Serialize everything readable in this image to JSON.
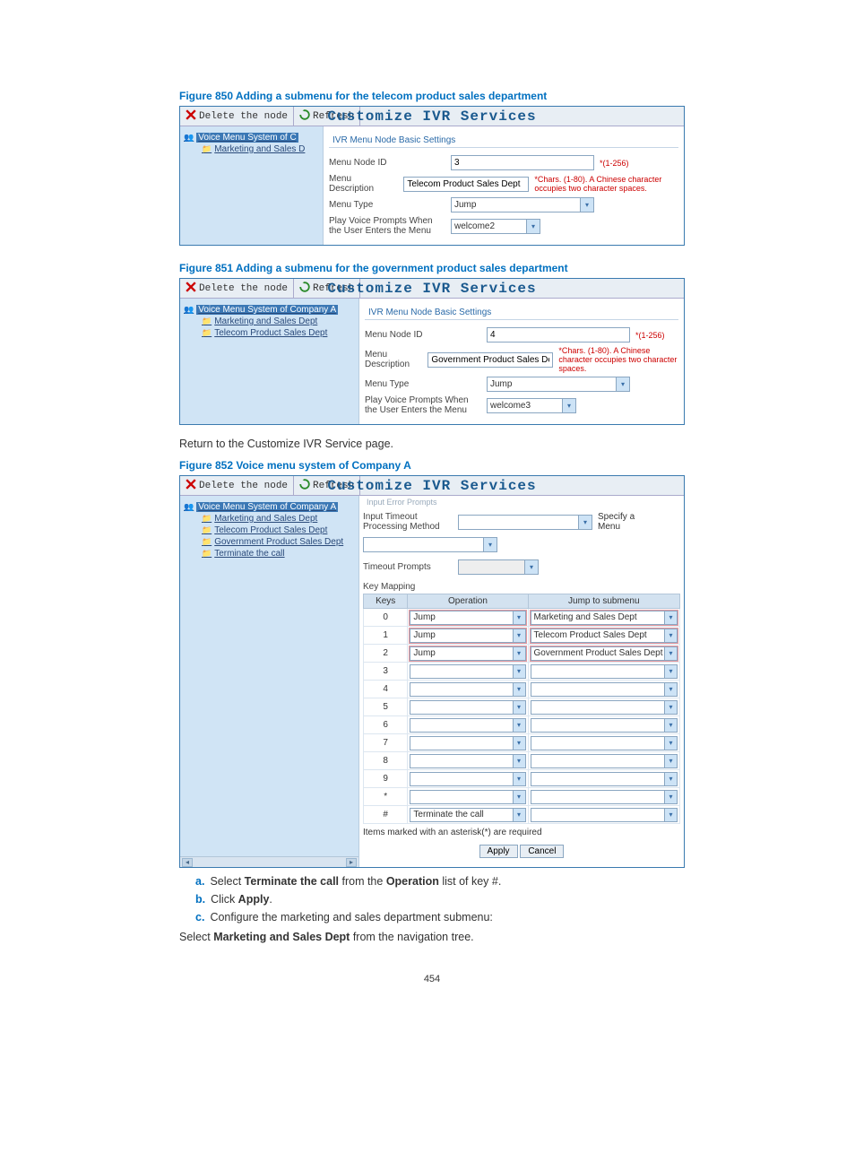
{
  "fig850": {
    "title": "Figure 850 Adding a submenu for the telecom product sales department",
    "banner": "Customize IVR Services",
    "delete": "Delete the node",
    "refresh": "Refresh",
    "tree": {
      "root": "Voice Menu System of C",
      "n1": "Marketing and Sales D"
    },
    "group": "IVR Menu Node Basic Settings",
    "fields": {
      "node_id_label": "Menu Node ID",
      "node_id_value": "3",
      "node_id_hint": "*(1-256)",
      "desc_label": "Menu Description",
      "desc_value": "Telecom Product Sales Dept",
      "desc_hint": "*Chars. (1-80). A Chinese character occupies two character spaces.",
      "type_label": "Menu Type",
      "type_value": "Jump",
      "prompt_label": "Play Voice Prompts When the User Enters the Menu",
      "prompt_value": "welcome2"
    }
  },
  "fig851": {
    "title": "Figure 851 Adding a submenu for the government product sales department",
    "banner": "Customize IVR Services",
    "delete": "Delete the node",
    "refresh": "Refresh",
    "tree": {
      "root": "Voice Menu System of Company A",
      "n1": "Marketing and Sales Dept",
      "n2": "Telecom Product Sales Dept"
    },
    "group": "IVR Menu Node Basic Settings",
    "fields": {
      "node_id_label": "Menu Node ID",
      "node_id_value": "4",
      "node_id_hint": "*(1-256)",
      "desc_label": "Menu Description",
      "desc_value": "Government Product Sales Dept",
      "desc_hint": "*Chars. (1-80). A Chinese character occupies two character spaces.",
      "type_label": "Menu Type",
      "type_value": "Jump",
      "prompt_label": "Play Voice Prompts When the User Enters the Menu",
      "prompt_value": "welcome3"
    }
  },
  "return_text": "Return to the Customize IVR Service page.",
  "fig852": {
    "title": "Figure 852 Voice menu system of Company A",
    "banner": "Customize IVR Services",
    "delete": "Delete the node",
    "refresh": "Refresh",
    "tree": {
      "root": "Voice Menu System of Company A",
      "n1": "Marketing and Sales Dept",
      "n2": "Telecom Product Sales Dept",
      "n3": "Government Product Sales Dept",
      "n4": "Terminate the call"
    },
    "partial_header": "Input Error Prompts",
    "timeout_method_label": "Input Timeout Processing Method",
    "timeout_method_value": "",
    "specify_label": "Specify a Menu",
    "timeout_prompts_label": "Timeout Prompts",
    "key_mapping": "Key Mapping",
    "cols": {
      "keys": "Keys",
      "op": "Operation",
      "sub": "Jump to submenu"
    },
    "rows": [
      {
        "key": "0",
        "op": "Jump",
        "sub": "Marketing and Sales Dept",
        "hl": true
      },
      {
        "key": "1",
        "op": "Jump",
        "sub": "Telecom Product Sales Dept",
        "hl": true
      },
      {
        "key": "2",
        "op": "Jump",
        "sub": "Government Product Sales Dept",
        "hl": true
      },
      {
        "key": "3",
        "op": "",
        "sub": ""
      },
      {
        "key": "4",
        "op": "",
        "sub": ""
      },
      {
        "key": "5",
        "op": "",
        "sub": ""
      },
      {
        "key": "6",
        "op": "",
        "sub": ""
      },
      {
        "key": "7",
        "op": "",
        "sub": ""
      },
      {
        "key": "8",
        "op": "",
        "sub": ""
      },
      {
        "key": "9",
        "op": "",
        "sub": ""
      },
      {
        "key": "*",
        "op": "",
        "sub": ""
      },
      {
        "key": "#",
        "op": "Terminate the call",
        "sub": ""
      }
    ],
    "note": "Items marked with an asterisk(*) are required",
    "apply": "Apply",
    "cancel": "Cancel"
  },
  "steps": {
    "a_prefix": "a.",
    "a_1": "Select ",
    "a_2": "Terminate the call",
    "a_3": " from the ",
    "a_4": "Operation",
    "a_5": " list of key #.",
    "b_prefix": "b.",
    "b_1": "Click ",
    "b_2": "Apply",
    "b_3": ".",
    "c_prefix": "c.",
    "c_1": "Configure the marketing and sales department submenu:"
  },
  "final_1": "Select ",
  "final_2": "Marketing and Sales Dept",
  "final_3": " from the navigation tree.",
  "page_num": "454"
}
